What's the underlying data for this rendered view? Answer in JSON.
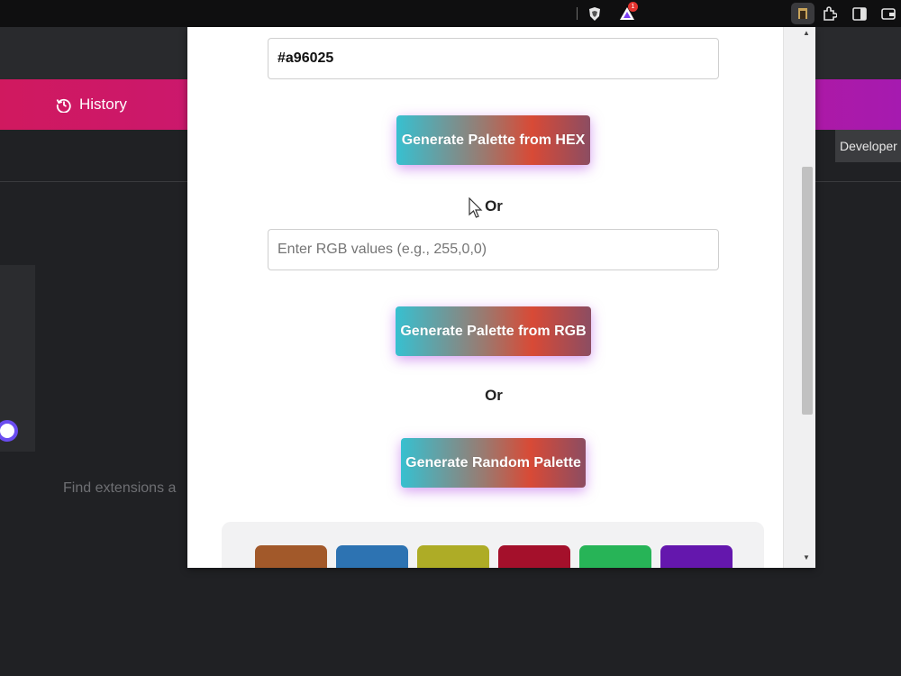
{
  "browser": {
    "icons": [
      "brave-shield-icon",
      "brave-rewards-icon",
      "extension-active-icon",
      "puzzle-icon",
      "sidepanel-icon",
      "wallet-icon"
    ],
    "rewards_badge": "1"
  },
  "page": {
    "history_label": "History",
    "developer_label": "Developer",
    "find_text": "Find extensions a"
  },
  "popup": {
    "hex_input": {
      "value": "#a96025"
    },
    "hex_button_label": "Generate Palette from HEX",
    "or_label_1": "Or",
    "rgb_input": {
      "value": "",
      "placeholder": "Enter RGB values (e.g., 255,0,0)"
    },
    "rgb_button_label": "Generate Palette from RGB",
    "or_label_2": "Or",
    "random_button_label": "Generate Random Palette",
    "swatches": [
      "#a2592a",
      "#2d73b2",
      "#aeac26",
      "#a4102b",
      "#27b457",
      "#6417ad"
    ]
  },
  "colors": {
    "accent_pink": "#d0195f",
    "accent_purple": "#a61ab0",
    "toggle_blue": "#6a4cf0"
  }
}
